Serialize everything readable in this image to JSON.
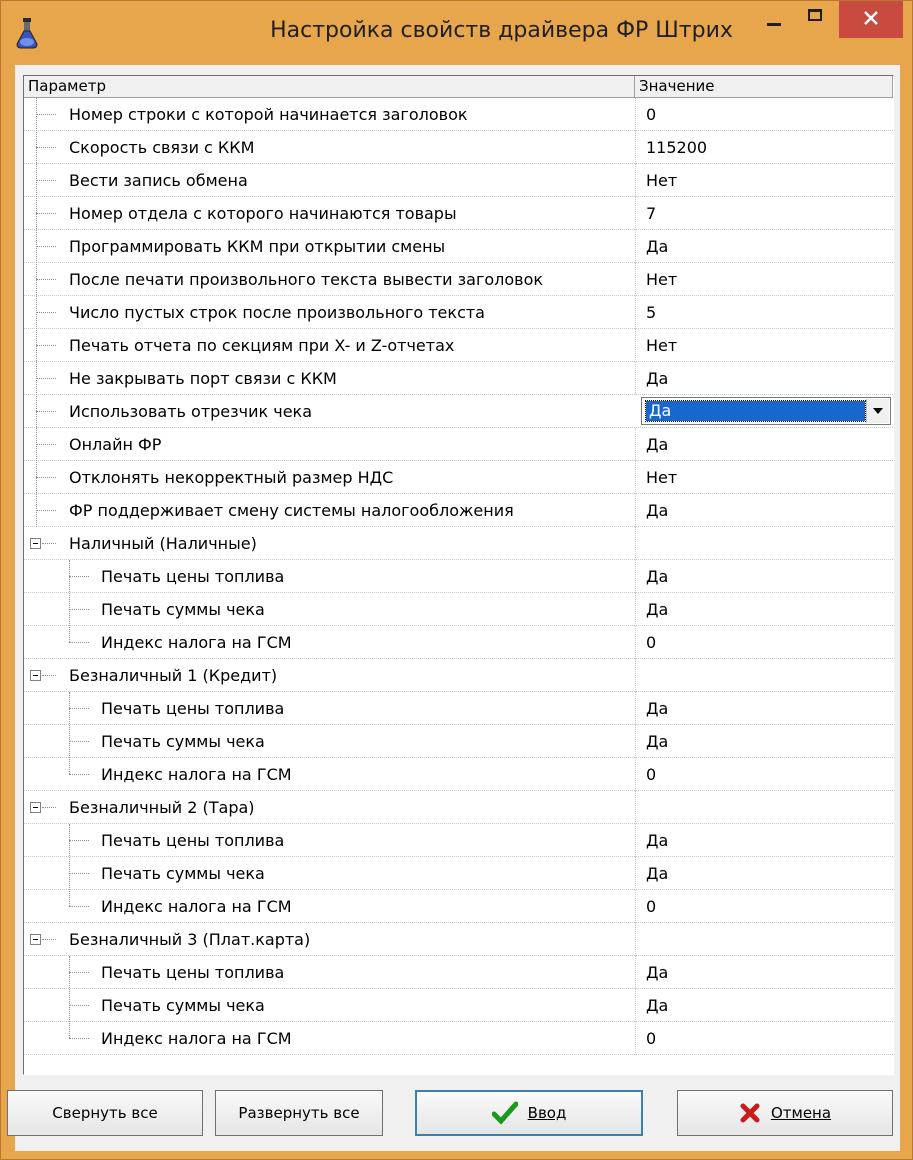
{
  "window": {
    "title": "Настройка свойств драйвера ФР Штрих"
  },
  "header": {
    "param": "Параметр",
    "value": "Значение"
  },
  "rows": [
    {
      "label": "Номер строки с которой начинается заголовок",
      "value": "0"
    },
    {
      "label": "Скорость связи с ККМ",
      "value": "115200"
    },
    {
      "label": "Вести запись обмена",
      "value": "Нет"
    },
    {
      "label": "Номер отдела с которого начинаются товары",
      "value": "7"
    },
    {
      "label": "Программировать ККМ при открытии смены",
      "value": "Да"
    },
    {
      "label": "После печати произвольного текста вывести заголовок",
      "value": "Нет"
    },
    {
      "label": "Число пустых строк после произвольного текста",
      "value": "5"
    },
    {
      "label": "Печать отчета по секциям при X- и Z-отчетах",
      "value": "Нет"
    },
    {
      "label": "Не закрывать порт связи с ККМ",
      "value": "Да"
    },
    {
      "label": "Использовать отрезчик чека",
      "value": "Да"
    },
    {
      "label": "Онлайн ФР",
      "value": "Да"
    },
    {
      "label": "Отклонять некорректный размер НДС",
      "value": "Нет"
    },
    {
      "label": "ФР поддерживает смену системы налогообложения",
      "value": "Да"
    }
  ],
  "groups": [
    {
      "label": "Наличный (Наличные)",
      "items": [
        {
          "label": "Печать цены топлива",
          "value": "Да"
        },
        {
          "label": "Печать суммы чека",
          "value": "Да"
        },
        {
          "label": "Индекс налога на ГСМ",
          "value": "0"
        }
      ]
    },
    {
      "label": "Безналичный 1 (Кредит)",
      "items": [
        {
          "label": "Печать цены топлива",
          "value": "Да"
        },
        {
          "label": "Печать суммы чека",
          "value": "Да"
        },
        {
          "label": "Индекс налога на ГСМ",
          "value": "0"
        }
      ]
    },
    {
      "label": "Безналичный 2 (Тара)",
      "items": [
        {
          "label": "Печать цены топлива",
          "value": "Да"
        },
        {
          "label": "Печать суммы чека",
          "value": "Да"
        },
        {
          "label": "Индекс налога на ГСМ",
          "value": "0"
        }
      ]
    },
    {
      "label": "Безналичный 3 (Плат.карта)",
      "items": [
        {
          "label": "Печать цены топлива",
          "value": "Да"
        },
        {
          "label": "Печать суммы чека",
          "value": "Да"
        },
        {
          "label": "Индекс налога на ГСМ",
          "value": "0"
        }
      ]
    }
  ],
  "buttons": {
    "collapse_all": "Свернуть все",
    "expand_all": "Развернуть все",
    "ok": "Ввод",
    "cancel": "Отмена"
  },
  "colors": {
    "titlebar": "#e7a54c",
    "close": "#c94b3f",
    "selection": "#1767cc"
  },
  "icons": {
    "app": "flask-icon",
    "ok": "checkmark-icon",
    "cancel": "red-x-icon"
  }
}
